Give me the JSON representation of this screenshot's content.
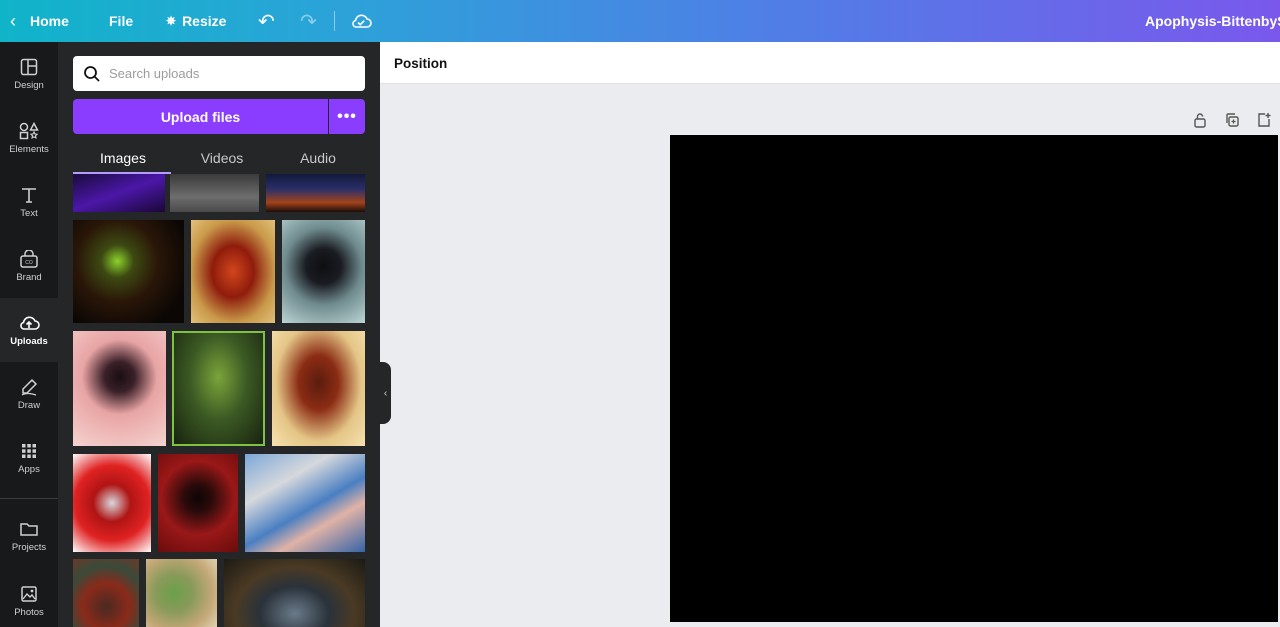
{
  "topbar": {
    "home_label": "Home",
    "file_label": "File",
    "resize_label": "Resize",
    "doc_title": "Apophysis-BittenbySp"
  },
  "rail": {
    "items": [
      {
        "label": "Design",
        "icon": "layout-icon"
      },
      {
        "label": "Elements",
        "icon": "shapes-icon"
      },
      {
        "label": "Text",
        "icon": "text-icon"
      },
      {
        "label": "Brand",
        "icon": "brand-icon"
      },
      {
        "label": "Uploads",
        "icon": "cloud-upload-icon"
      },
      {
        "label": "Draw",
        "icon": "pen-icon"
      },
      {
        "label": "Apps",
        "icon": "apps-grid-icon"
      },
      {
        "label": "Projects",
        "icon": "folder-icon"
      },
      {
        "label": "Photos",
        "icon": "image-icon"
      }
    ],
    "active": "Uploads"
  },
  "uploads": {
    "search_placeholder": "Search uploads",
    "upload_button": "Upload files",
    "tabs": [
      "Images",
      "Videos",
      "Audio"
    ],
    "active_tab": "Images"
  },
  "toolbar": {
    "position_label": "Position"
  },
  "colors": {
    "accent": "#8b3dff",
    "panel_bg": "#252627",
    "rail_bg": "#18191b",
    "canvas_bg": "#000000"
  }
}
